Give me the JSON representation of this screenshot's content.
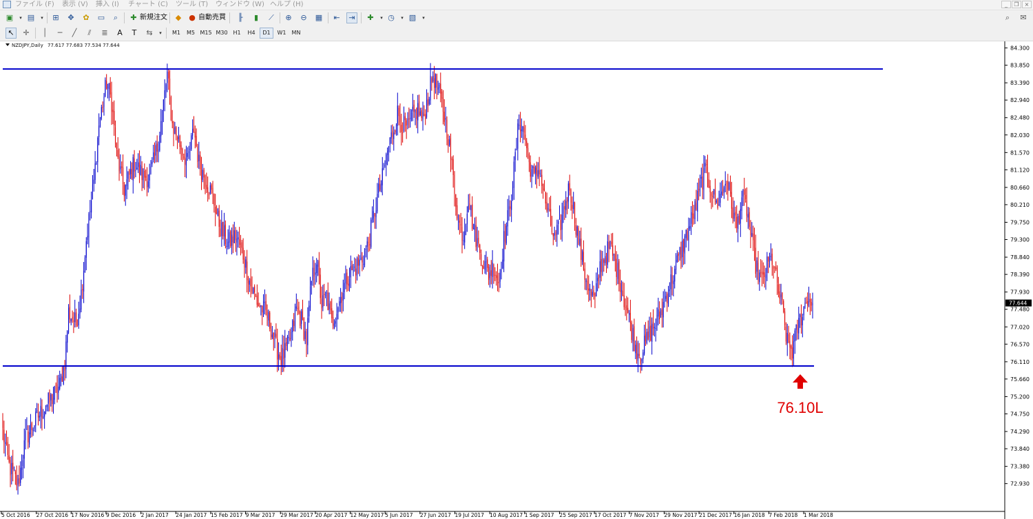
{
  "menu": {
    "items": [
      "ファイル (F)",
      "表示 (V)",
      "挿入 (I)",
      "チャート (C)",
      "ツール (T)",
      "ウィンドウ (W)",
      "ヘルプ (H)"
    ]
  },
  "toolbar": {
    "new_order_label": "新規注文",
    "auto_trading_label": "自動売買",
    "timeframes": [
      "M1",
      "M5",
      "M15",
      "M30",
      "H1",
      "H4",
      "D1",
      "W1",
      "MN"
    ],
    "active_timeframe": "D1"
  },
  "chart_info": {
    "symbol": "NZDJPY,Daily",
    "ohlc": "77.617 77.683 77.534 77.644"
  },
  "chart_data": {
    "type": "candlestick",
    "symbol": "NZDJPY",
    "timeframe": "Daily",
    "ylim": [
      72.6,
      84.4
    ],
    "price_ticks": [
      "84.300",
      "83.850",
      "83.390",
      "82.940",
      "82.480",
      "82.030",
      "81.570",
      "81.120",
      "80.660",
      "80.210",
      "79.750",
      "79.300",
      "78.840",
      "78.390",
      "77.930",
      "77.480",
      "77.020",
      "76.570",
      "76.110",
      "75.660",
      "75.200",
      "74.750",
      "74.290",
      "73.840",
      "73.380",
      "72.930"
    ],
    "date_ticks": [
      "5 Oct 2016",
      "27 Oct 2016",
      "17 Nov 2016",
      "9 Dec 2016",
      "2 Jan 2017",
      "24 Jan 2017",
      "15 Feb 2017",
      "9 Mar 2017",
      "29 Mar 2017",
      "20 Apr 2017",
      "12 May 2017",
      "5 Jun 2017",
      "27 Jun 2017",
      "19 Jul 2017",
      "10 Aug 2017",
      "1 Sep 2017",
      "25 Sep 2017",
      "17 Oct 2017",
      "7 Nov 2017",
      "29 Nov 2017",
      "21 Dec 2017",
      "16 Jan 2018",
      "7 Feb 2018",
      "1 Mar 2018"
    ],
    "current_price": "77.644",
    "resistance_level": 83.75,
    "support_level": 76.0,
    "annotation_text": "76.10L",
    "up_color": "#0000cc",
    "down_color": "#dd0000",
    "line_color": "#0000cc",
    "annotation_color": "#e00000",
    "approx_path_anchors": [
      [
        0,
        74.3
      ],
      [
        5,
        73.4
      ],
      [
        12,
        72.9
      ],
      [
        18,
        74.1
      ],
      [
        28,
        74.7
      ],
      [
        40,
        75.2
      ],
      [
        45,
        75.5
      ],
      [
        49,
        76.1
      ],
      [
        52,
        77.4
      ],
      [
        58,
        77.1
      ],
      [
        62,
        77.9
      ],
      [
        66,
        79.3
      ],
      [
        72,
        80.8
      ],
      [
        76,
        82.3
      ],
      [
        82,
        83.4
      ],
      [
        86,
        82.9
      ],
      [
        90,
        81.5
      ],
      [
        96,
        80.6
      ],
      [
        104,
        81.3
      ],
      [
        110,
        81.0
      ],
      [
        116,
        80.9
      ],
      [
        122,
        81.7
      ],
      [
        126,
        82.6
      ],
      [
        130,
        83.6
      ],
      [
        134,
        82.3
      ],
      [
        140,
        81.8
      ],
      [
        146,
        81.3
      ],
      [
        151,
        82.2
      ],
      [
        155,
        81.3
      ],
      [
        160,
        80.9
      ],
      [
        166,
        80.4
      ],
      [
        172,
        79.6
      ],
      [
        178,
        79.2
      ],
      [
        184,
        79.4
      ],
      [
        190,
        78.9
      ],
      [
        196,
        78.1
      ],
      [
        202,
        77.6
      ],
      [
        208,
        77.4
      ],
      [
        212,
        77.0
      ],
      [
        216,
        76.5
      ],
      [
        220,
        76.2
      ],
      [
        224,
        76.4
      ],
      [
        228,
        76.8
      ],
      [
        232,
        77.5
      ],
      [
        236,
        77.2
      ],
      [
        240,
        76.7
      ],
      [
        244,
        78.2
      ],
      [
        248,
        78.8
      ],
      [
        252,
        77.6
      ],
      [
        256,
        77.8
      ],
      [
        260,
        77.1
      ],
      [
        264,
        77.5
      ],
      [
        268,
        77.9
      ],
      [
        272,
        78.3
      ],
      [
        276,
        78.5
      ],
      [
        280,
        78.6
      ],
      [
        284,
        78.8
      ],
      [
        288,
        79.1
      ],
      [
        292,
        79.7
      ],
      [
        296,
        80.4
      ],
      [
        300,
        80.9
      ],
      [
        304,
        81.6
      ],
      [
        308,
        82.1
      ],
      [
        312,
        82.6
      ],
      [
        316,
        82.3
      ],
      [
        320,
        82.2
      ],
      [
        324,
        82.5
      ],
      [
        328,
        82.7
      ],
      [
        332,
        82.4
      ],
      [
        336,
        83.0
      ],
      [
        340,
        83.6
      ],
      [
        344,
        83.2
      ],
      [
        348,
        82.7
      ],
      [
        352,
        82.0
      ],
      [
        356,
        80.9
      ],
      [
        360,
        79.8
      ],
      [
        364,
        79.4
      ],
      [
        368,
        80.4
      ],
      [
        372,
        79.6
      ],
      [
        376,
        79.1
      ],
      [
        380,
        78.7
      ],
      [
        384,
        78.4
      ],
      [
        388,
        78.6
      ],
      [
        392,
        78.2
      ],
      [
        396,
        79.3
      ],
      [
        400,
        80.0
      ],
      [
        404,
        81.1
      ],
      [
        408,
        82.4
      ],
      [
        412,
        82.1
      ],
      [
        416,
        81.3
      ],
      [
        420,
        80.9
      ],
      [
        424,
        81.2
      ],
      [
        428,
        80.4
      ],
      [
        432,
        79.8
      ],
      [
        436,
        79.3
      ],
      [
        440,
        79.6
      ],
      [
        444,
        80.2
      ],
      [
        448,
        80.7
      ],
      [
        452,
        79.9
      ],
      [
        456,
        79.1
      ],
      [
        460,
        78.4
      ],
      [
        464,
        77.9
      ],
      [
        468,
        77.7
      ],
      [
        472,
        78.6
      ],
      [
        476,
        78.9
      ],
      [
        480,
        79.1
      ],
      [
        484,
        78.7
      ],
      [
        488,
        78.2
      ],
      [
        492,
        77.6
      ],
      [
        496,
        77.1
      ],
      [
        500,
        76.5
      ],
      [
        504,
        76.3
      ],
      [
        508,
        76.6
      ],
      [
        512,
        76.9
      ],
      [
        516,
        77.1
      ],
      [
        520,
        77.4
      ],
      [
        524,
        77.8
      ],
      [
        528,
        78.2
      ],
      [
        532,
        78.6
      ],
      [
        536,
        79.0
      ],
      [
        540,
        79.4
      ],
      [
        544,
        79.8
      ],
      [
        548,
        80.2
      ],
      [
        552,
        80.8
      ],
      [
        556,
        81.1
      ],
      [
        560,
        80.6
      ],
      [
        564,
        80.2
      ],
      [
        568,
        80.5
      ],
      [
        572,
        80.9
      ],
      [
        576,
        80.2
      ],
      [
        580,
        79.6
      ],
      [
        584,
        80.4
      ],
      [
        588,
        80.1
      ],
      [
        592,
        79.2
      ],
      [
        596,
        78.5
      ],
      [
        600,
        78.2
      ],
      [
        604,
        78.6
      ],
      [
        608,
        78.8
      ],
      [
        612,
        78.1
      ],
      [
        616,
        77.5
      ],
      [
        620,
        76.6
      ],
      [
        624,
        76.4
      ],
      [
        628,
        77.0
      ],
      [
        632,
        77.4
      ],
      [
        636,
        77.8
      ],
      [
        640,
        77.6
      ]
    ]
  }
}
